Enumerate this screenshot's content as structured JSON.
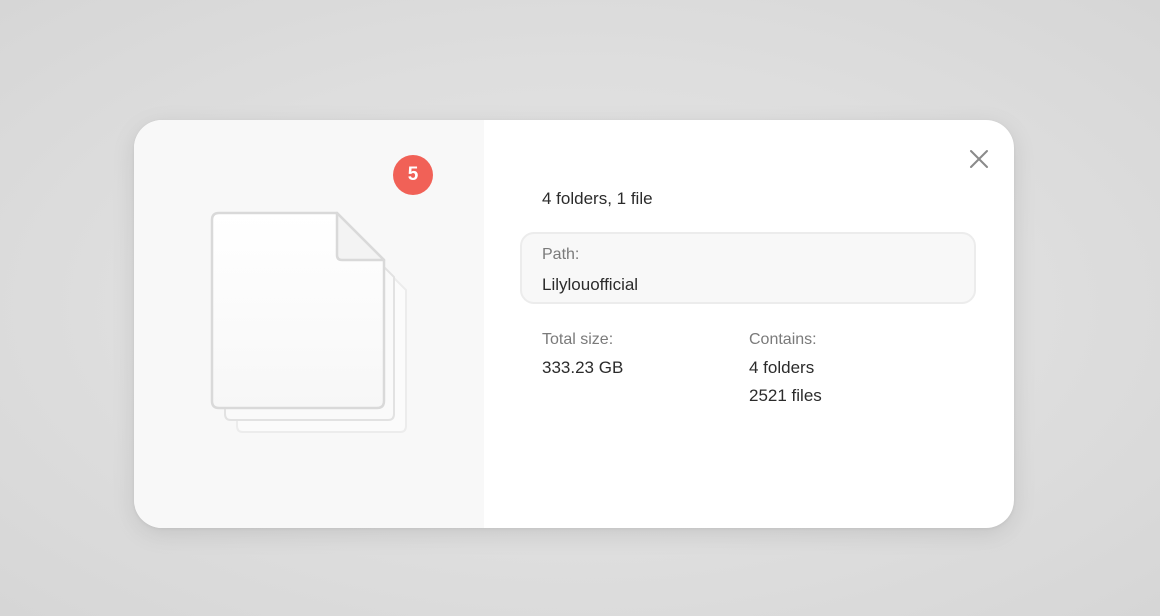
{
  "preview": {
    "badge_count": "5",
    "icon": "document-stack-icon"
  },
  "details": {
    "summary": "4 folders, 1 file",
    "path": {
      "label": "Path:",
      "value": "Lilylouofficial"
    },
    "total_size": {
      "label": "Total size:",
      "value": "333.23 GB"
    },
    "contains": {
      "label": "Contains:",
      "folders": "4 folders",
      "files": "2521 files"
    },
    "close_icon": "close-icon"
  },
  "colors": {
    "badge": "#f16157",
    "text_primary": "#2b2b2b",
    "text_secondary": "#7a7a7a",
    "preview_bg": "#f8f8f8",
    "page_bg": "#dedede"
  }
}
